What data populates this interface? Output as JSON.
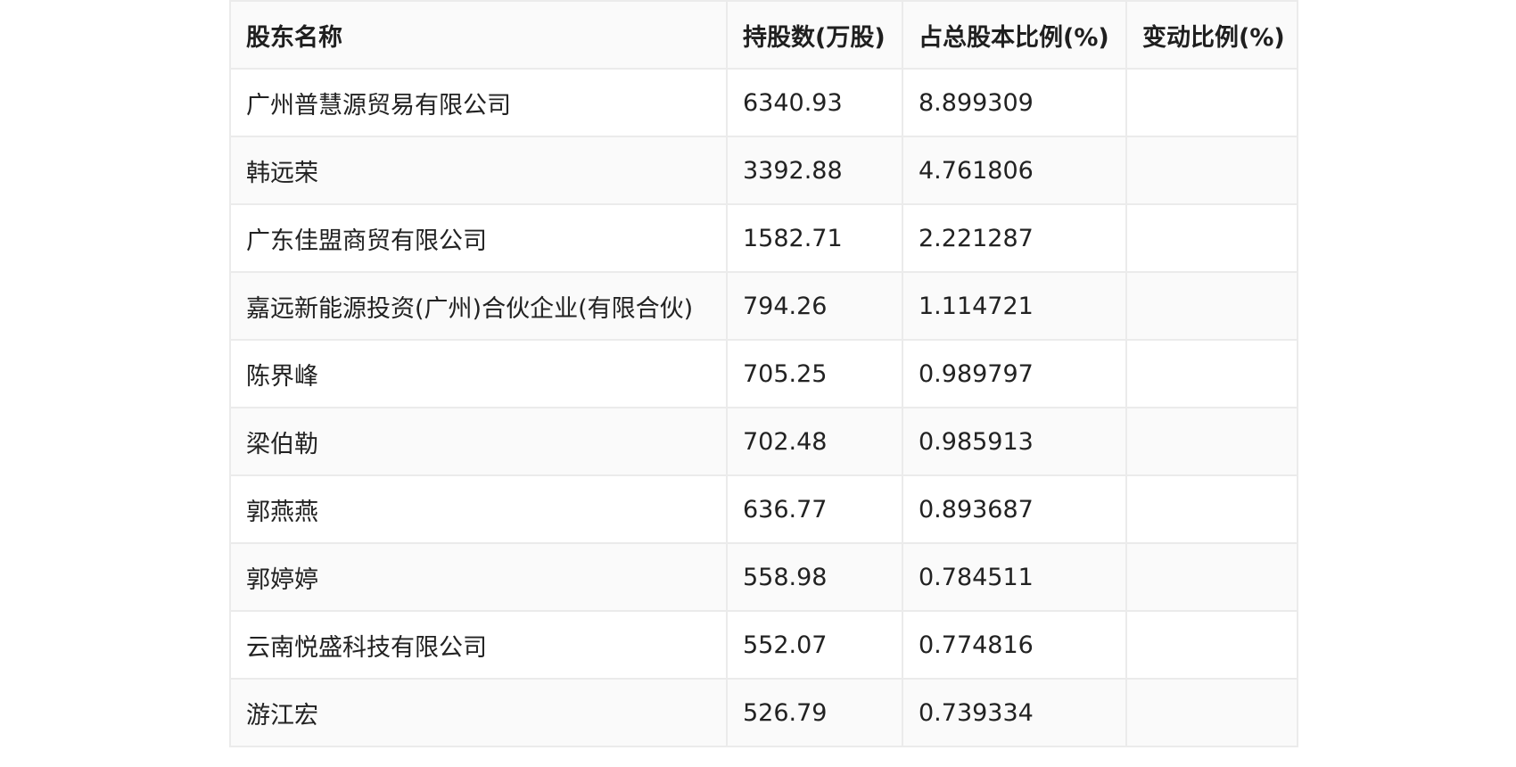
{
  "table": {
    "headers": [
      "股东名称",
      "持股数(万股)",
      "占总股本比例(%)",
      "变动比例(%)"
    ],
    "rows": [
      [
        "广州普慧源贸易有限公司",
        "6340.93",
        "8.899309",
        ""
      ],
      [
        "韩远荣",
        "3392.88",
        "4.761806",
        ""
      ],
      [
        "广东佳盟商贸有限公司",
        "1582.71",
        "2.221287",
        ""
      ],
      [
        "嘉远新能源投资(广州)合伙企业(有限合伙)",
        "794.26",
        "1.114721",
        ""
      ],
      [
        "陈界峰",
        "705.25",
        "0.989797",
        ""
      ],
      [
        "梁伯勒",
        "702.48",
        "0.985913",
        ""
      ],
      [
        "郭燕燕",
        "636.77",
        "0.893687",
        ""
      ],
      [
        "郭婷婷",
        "558.98",
        "0.784511",
        ""
      ],
      [
        "云南悦盛科技有限公司",
        "552.07",
        "0.774816",
        ""
      ],
      [
        "游江宏",
        "526.79",
        "0.739334",
        ""
      ]
    ]
  }
}
